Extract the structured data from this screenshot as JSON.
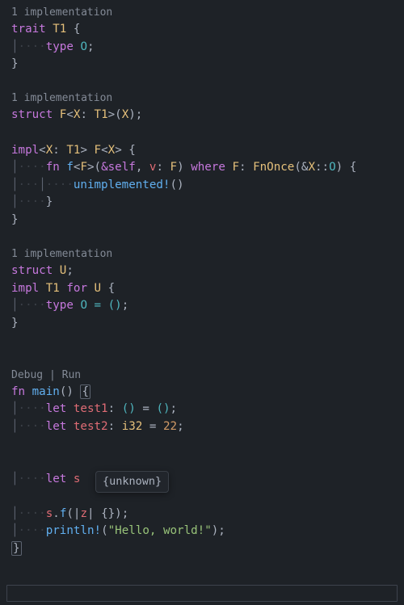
{
  "lens": {
    "impl1": "1 implementation",
    "impl2": "1 implementation",
    "impl3": "1 implementation",
    "debugRun": "Debug | Run"
  },
  "kw": {
    "trait": "trait",
    "type": "type",
    "struct": "struct",
    "impl": "impl",
    "fn": "fn",
    "where": "where",
    "for": "for",
    "let": "let",
    "self_amp": "&self"
  },
  "ty": {
    "T1": "T1",
    "F": "F",
    "X": "X",
    "Fgen": "F",
    "U": "U",
    "FnOnce": "FnOnce",
    "i32": "i32"
  },
  "fn": {
    "f": "f",
    "main": "main"
  },
  "mac": {
    "unimpl": "unimplemented!",
    "println": "println!"
  },
  "id": {
    "v": "v",
    "test1": "test1",
    "test2": "test2",
    "s": "s",
    "z": "z"
  },
  "lit": {
    "O": "O",
    "unit": "()",
    "eq_unit": " = ()"
  },
  "num": {
    "n22": "22"
  },
  "str": {
    "hello": "\"Hello, world!\""
  },
  "punc": {
    "lb": "{",
    "rb": "}",
    "semi": ";",
    "lp": "(",
    "rp": ")",
    "lt": "<",
    "gt": ">",
    "colon": ":",
    "comma": ",",
    "amp": "&",
    "col2": "::",
    "eq": "=",
    "dot": ".",
    "bar": "|",
    "rp_semi": ");",
    "rb_semi": "});",
    "closure_empty": " {});"
  },
  "ws": {
    "d4": "····",
    "d8": "········",
    "s1": " ",
    "s2": "  ",
    "guide": "│"
  },
  "tooltip": "{unknown}",
  "hidden": ");"
}
